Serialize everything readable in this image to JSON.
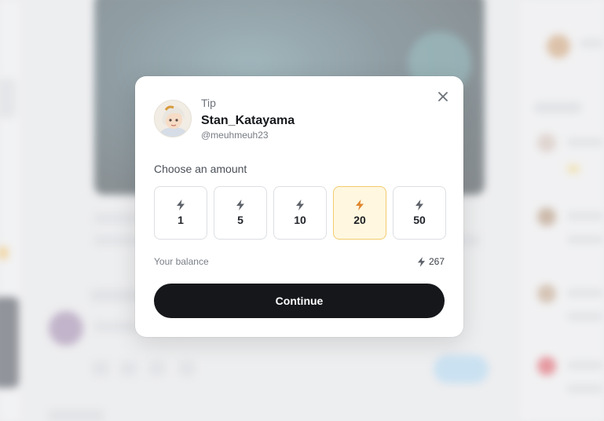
{
  "modal": {
    "kicker": "Tip",
    "creator_name": "Stan_Katayama",
    "creator_handle": "@meuhmeuh23",
    "amount_label": "Choose an amount",
    "amounts": [
      {
        "value": "1",
        "selected": false
      },
      {
        "value": "5",
        "selected": false
      },
      {
        "value": "10",
        "selected": false
      },
      {
        "value": "20",
        "selected": true
      },
      {
        "value": "50",
        "selected": false
      }
    ],
    "balance_label": "Your balance",
    "balance_value": "267",
    "continue_label": "Continue",
    "icons": {
      "close": "close-icon",
      "amount": "lightning-icon",
      "balance": "lightning-icon"
    }
  },
  "colors": {
    "accent_selected_bg": "#fff7e0",
    "accent_selected_border": "#f3cc6e",
    "accent_selected_icon": "#e0862c",
    "primary_button": "#15171b"
  }
}
